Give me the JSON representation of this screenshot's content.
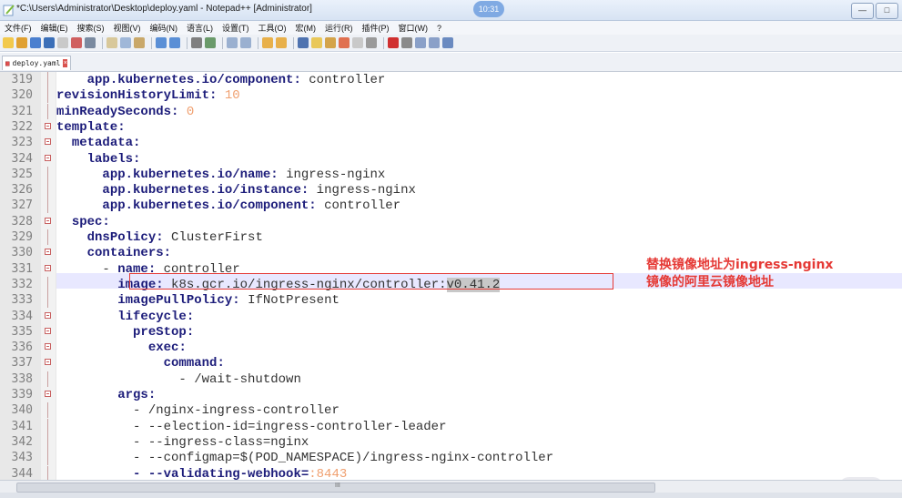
{
  "window": {
    "title": "*C:\\Users\\Administrator\\Desktop\\deploy.yaml - Notepad++ [Administrator]",
    "clock": "10:31",
    "buttons": [
      "—",
      "□"
    ]
  },
  "menu": [
    "文件(F)",
    "编辑(E)",
    "搜索(S)",
    "视图(V)",
    "编码(N)",
    "语言(L)",
    "设置(T)",
    "工具(O)",
    "宏(M)",
    "运行(R)",
    "插件(P)",
    "窗口(W)",
    "?"
  ],
  "tab": {
    "label": "deploy.yaml",
    "close": "×"
  },
  "lines": [
    {
      "num": "319",
      "indent": "    ",
      "key": "app.kubernetes.io/component",
      "sep": ": ",
      "value": "controller",
      "vtype": "v"
    },
    {
      "num": "320",
      "indent": "",
      "key": "revisionHistoryLimit",
      "sep": ": ",
      "value": "10",
      "vtype": "n"
    },
    {
      "num": "321",
      "indent": "",
      "key": "minReadySeconds",
      "sep": ": ",
      "value": "0",
      "vtype": "n"
    },
    {
      "num": "322",
      "indent": "",
      "key": "template",
      "sep": ":",
      "value": "",
      "vtype": "v"
    },
    {
      "num": "323",
      "indent": "  ",
      "key": "metadata",
      "sep": ":",
      "value": "",
      "vtype": "v"
    },
    {
      "num": "324",
      "indent": "    ",
      "key": "labels",
      "sep": ":",
      "value": "",
      "vtype": "v"
    },
    {
      "num": "325",
      "indent": "      ",
      "key": "app.kubernetes.io/name",
      "sep": ": ",
      "value": "ingress-nginx",
      "vtype": "v"
    },
    {
      "num": "326",
      "indent": "      ",
      "key": "app.kubernetes.io/instance",
      "sep": ": ",
      "value": "ingress-nginx",
      "vtype": "v"
    },
    {
      "num": "327",
      "indent": "      ",
      "key": "app.kubernetes.io/component",
      "sep": ": ",
      "value": "controller",
      "vtype": "v"
    },
    {
      "num": "328",
      "indent": "  ",
      "key": "spec",
      "sep": ":",
      "value": "",
      "vtype": "v"
    },
    {
      "num": "329",
      "indent": "    ",
      "key": "dnsPolicy",
      "sep": ": ",
      "value": "ClusterFirst",
      "vtype": "v"
    },
    {
      "num": "330",
      "indent": "    ",
      "key": "containers",
      "sep": ":",
      "value": "",
      "vtype": "v"
    },
    {
      "num": "331",
      "indent": "      - ",
      "key": "name",
      "sep": ": ",
      "value": "controller",
      "vtype": "v"
    },
    {
      "num": "332",
      "indent": "        ",
      "key": "image",
      "sep": ": ",
      "value": "k8s.gcr.io/ingress-nginx/controller:",
      "value2": "v0.41.2",
      "vtype": "v"
    },
    {
      "num": "333",
      "indent": "        ",
      "key": "imagePullPolicy",
      "sep": ": ",
      "value": "IfNotPresent",
      "vtype": "v"
    },
    {
      "num": "334",
      "indent": "        ",
      "key": "lifecycle",
      "sep": ":",
      "value": "",
      "vtype": "v"
    },
    {
      "num": "335",
      "indent": "          ",
      "key": "preStop",
      "sep": ":",
      "value": "",
      "vtype": "v"
    },
    {
      "num": "336",
      "indent": "            ",
      "key": "exec",
      "sep": ":",
      "value": "",
      "vtype": "v"
    },
    {
      "num": "337",
      "indent": "              ",
      "key": "command",
      "sep": ":",
      "value": "",
      "vtype": "v"
    },
    {
      "num": "338",
      "indent": "                ",
      "key": "",
      "sep": "",
      "value": "- /wait-shutdown",
      "vtype": "v"
    },
    {
      "num": "339",
      "indent": "        ",
      "key": "args",
      "sep": ":",
      "value": "",
      "vtype": "v"
    },
    {
      "num": "340",
      "indent": "          ",
      "key": "",
      "sep": "",
      "value": "- /nginx-ingress-controller",
      "vtype": "v"
    },
    {
      "num": "341",
      "indent": "          ",
      "key": "",
      "sep": "",
      "value": "- --election-id=ingress-controller-leader",
      "vtype": "v"
    },
    {
      "num": "342",
      "indent": "          ",
      "key": "",
      "sep": "",
      "value": "- --ingress-class=nginx",
      "vtype": "v"
    },
    {
      "num": "343",
      "indent": "          ",
      "key": "",
      "sep": "",
      "value": "- --configmap=$(POD_NAMESPACE)/ingress-nginx-controller",
      "vtype": "v"
    },
    {
      "num": "344",
      "indent": "          ",
      "key": "- --validating-webhook=",
      "sep": "",
      "value": ":8443",
      "vtype": "n"
    }
  ],
  "annotation": {
    "line1": "替换镜像地址为ingress-nginx",
    "line2": "镜像的阿里云镜像地址"
  },
  "scrollbar_grip": "III",
  "colors": {
    "annotation": "#e53935",
    "key": "#1c1c7a",
    "number": "#f0a070"
  }
}
